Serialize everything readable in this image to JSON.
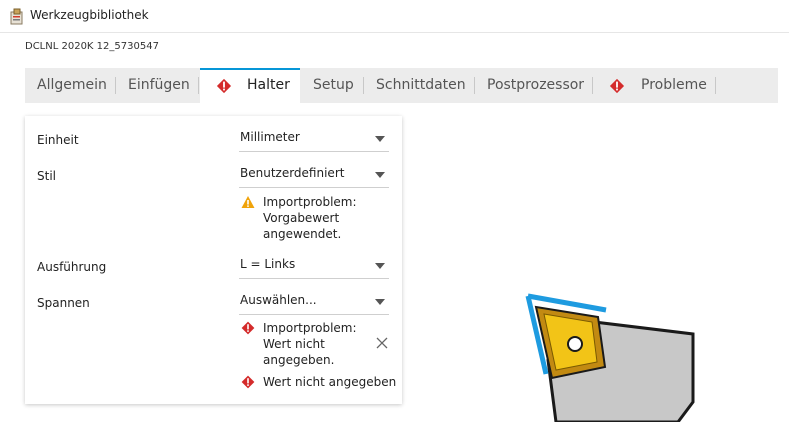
{
  "window": {
    "title": "Werkzeugbibliothek"
  },
  "tool_name": "DCLNL 2020K 12_5730547",
  "tabs": [
    {
      "label": "Allgemein",
      "active": false,
      "error": false
    },
    {
      "label": "Einfügen",
      "active": false,
      "error": false
    },
    {
      "label": "Halter",
      "active": true,
      "error": true
    },
    {
      "label": "Setup",
      "active": false,
      "error": false
    },
    {
      "label": "Schnittdaten",
      "active": false,
      "error": false
    },
    {
      "label": "Postprozessor",
      "active": false,
      "error": false
    },
    {
      "label": "Probleme",
      "active": false,
      "error": true
    }
  ],
  "form": {
    "einheit": {
      "label": "Einheit",
      "value": "Millimeter"
    },
    "stil": {
      "label": "Stil",
      "value": "Benutzerdefiniert",
      "warning": [
        "Importproblem:",
        "Vorgabewert",
        "angewendet."
      ]
    },
    "ausfuehrung": {
      "label": "Ausführung",
      "value": "L = Links"
    },
    "spannen": {
      "label": "Spannen",
      "value": "Auswählen...",
      "error": [
        "Importproblem:",
        "Wert nicht",
        "angegeben."
      ],
      "error2": "Wert nicht angegeben"
    }
  },
  "colors": {
    "accent": "#0696d7",
    "error": "#d42b2b",
    "warning": "#f0a30a",
    "insert": "#f2c417"
  },
  "icons": {
    "app": "tool-library-icon",
    "error": "error-diamond-icon",
    "warning": "warning-triangle-icon",
    "close": "close-icon",
    "dropdown": "chevron-down-icon"
  }
}
